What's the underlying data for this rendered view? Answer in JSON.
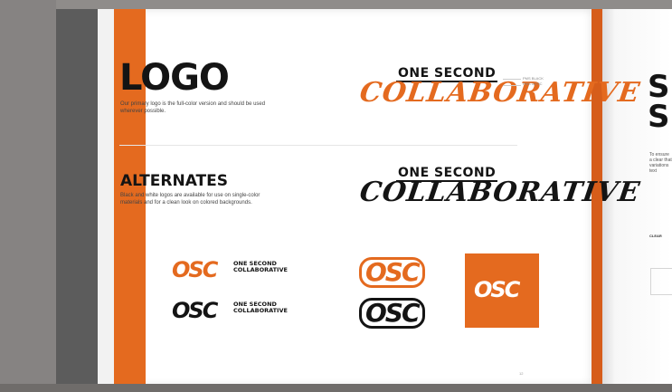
{
  "left_page": {
    "logo_title": "LOGO",
    "logo_description": "Our primary logo is the full-color version and should be used wherever possible.",
    "alternates_title": "ALTERNATES",
    "alternates_description": "Black and white logos are available for use on single-color materials and for a clean look on colored backgrounds.",
    "lockup_small": "ONE SECOND",
    "lockup_script": "COLLABORATIVE",
    "monogram": "OSC",
    "stack_line1": "ONE SECOND",
    "stack_line2": "COLLABORATIVE",
    "pms_label_1": "PMS BLACK",
    "pms_label_2": "PMS 1675C",
    "page_number": "12"
  },
  "right_page": {
    "title_line1": "S",
    "title_line2": "S",
    "body_text": "To ensure a clear that variations text",
    "label": "CLEAR"
  },
  "colors": {
    "brand_orange": "#e46a1f",
    "brand_black": "#141414",
    "page_white": "#ffffff",
    "band_grey": "#5c5c5c"
  }
}
